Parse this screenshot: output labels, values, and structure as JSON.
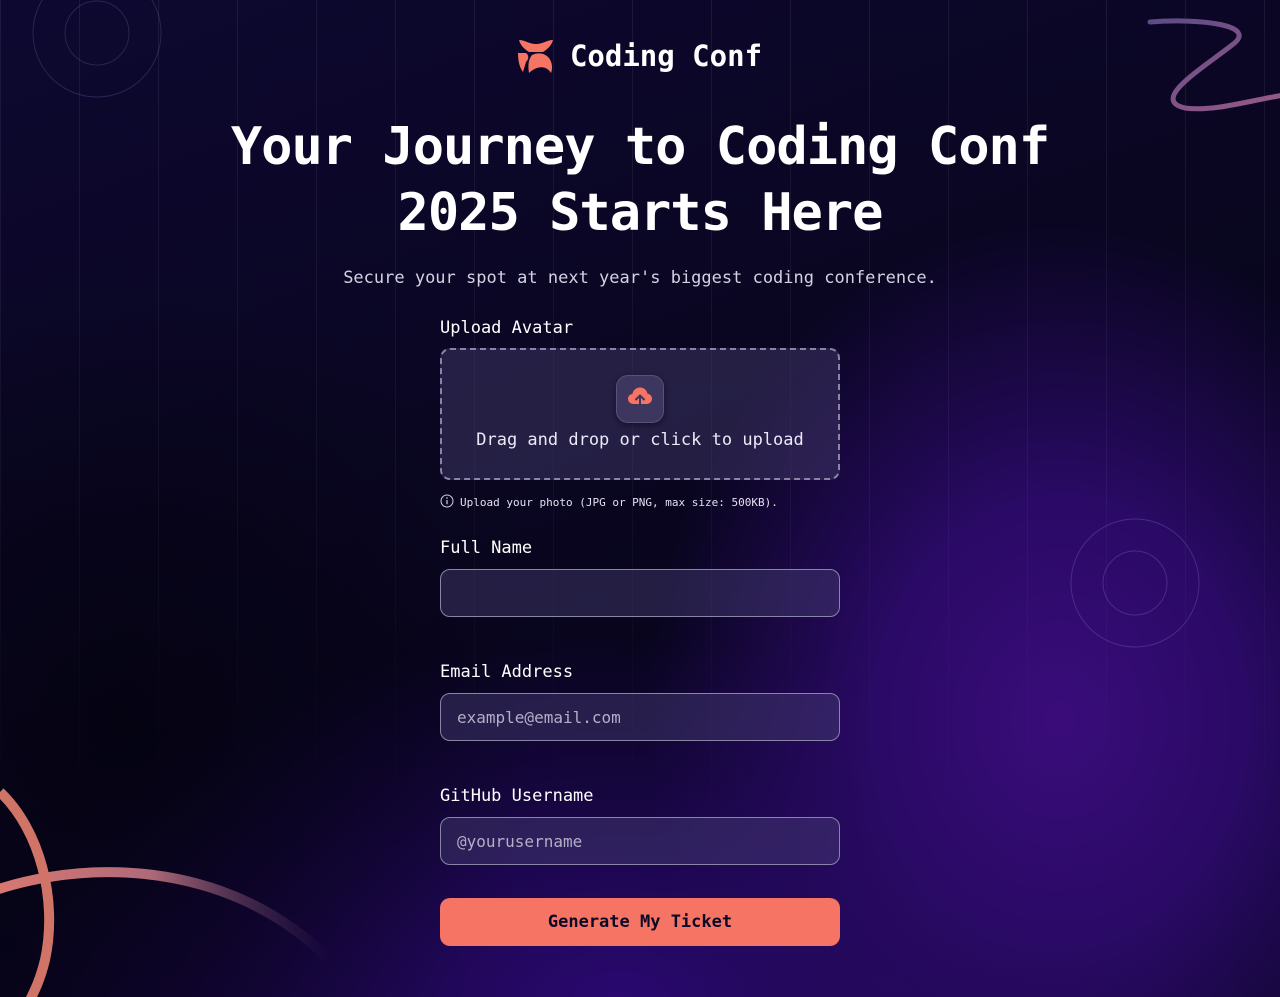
{
  "brand": {
    "name": "Coding Conf",
    "accent": "#f57463",
    "logo_icon": "coding-conf-logo-icon"
  },
  "hero": {
    "title_line1": "Your Journey to Coding Conf",
    "title_line2": "2025 Starts Here",
    "subtitle": "Secure your spot at next year's biggest coding conference."
  },
  "form": {
    "avatar": {
      "label": "Upload Avatar",
      "dropzone_text": "Drag and drop or click to upload",
      "icon": "cloud-upload-icon",
      "hint": "Upload your photo (JPG or PNG, max size: 500KB).",
      "hint_icon": "info-icon"
    },
    "full_name": {
      "label": "Full Name",
      "value": "",
      "placeholder": ""
    },
    "email": {
      "label": "Email Address",
      "value": "",
      "placeholder": "example@email.com"
    },
    "github": {
      "label": "GitHub Username",
      "value": "",
      "placeholder": "@yourusername"
    },
    "submit_label": "Generate My Ticket"
  },
  "colors": {
    "background": "#0a0522",
    "accent": "#f57463",
    "input_border": "#8a84a5",
    "text": "#ffffff"
  }
}
